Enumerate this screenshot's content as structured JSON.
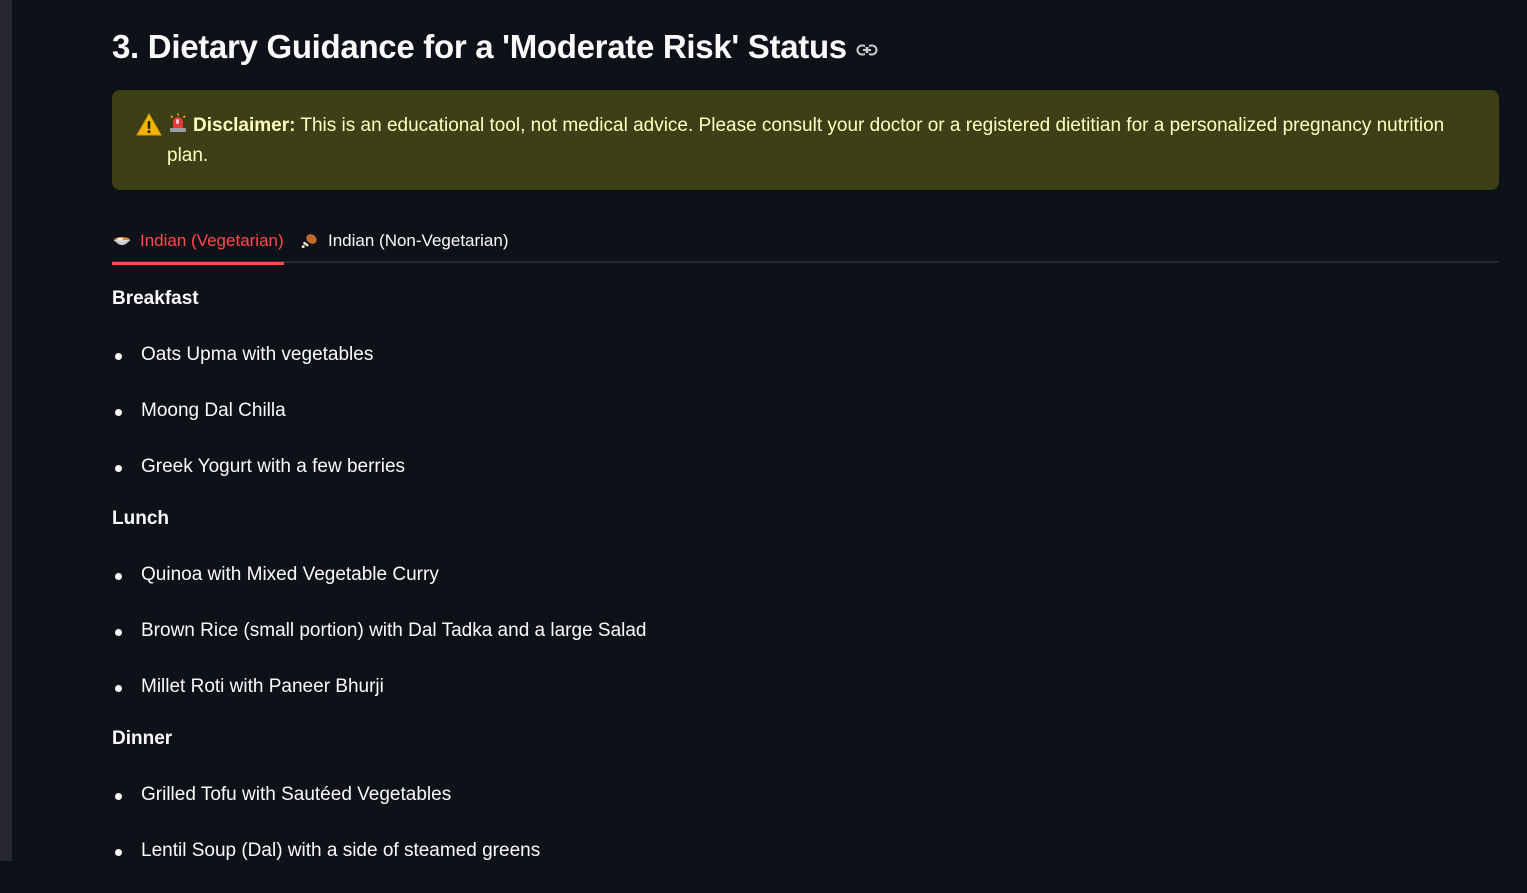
{
  "header": {
    "title": "3. Dietary Guidance for a 'Moderate Risk' Status",
    "link_icon": "link-icon"
  },
  "disclaimer": {
    "icon": "warning-icon",
    "emoji": "siren-icon",
    "label": "Disclaimer:",
    "text": " This is an educational tool, not medical advice. Please consult your doctor or a registered dietitian for a personalized pregnancy nutrition plan.",
    "colors": {
      "background": "#3d3f16",
      "text": "#ffffc2"
    }
  },
  "tabs": [
    {
      "icon": "curry-bowl-icon",
      "label": "Indian (Vegetarian)",
      "active": true
    },
    {
      "icon": "poultry-leg-icon",
      "label": "Indian (Non-Vegetarian)",
      "active": false
    }
  ],
  "accent_color": "#ff4b4b",
  "sections": [
    {
      "heading": "Breakfast",
      "items": [
        "Oats Upma with vegetables",
        "Moong Dal Chilla",
        "Greek Yogurt with a few berries"
      ]
    },
    {
      "heading": "Lunch",
      "items": [
        "Quinoa with Mixed Vegetable Curry",
        "Brown Rice (small portion) with Dal Tadka and a large Salad",
        "Millet Roti with Paneer Bhurji"
      ]
    },
    {
      "heading": "Dinner",
      "items": [
        "Grilled Tofu with Sautéed Vegetables",
        "Lentil Soup (Dal) with a side of steamed greens"
      ]
    }
  ]
}
